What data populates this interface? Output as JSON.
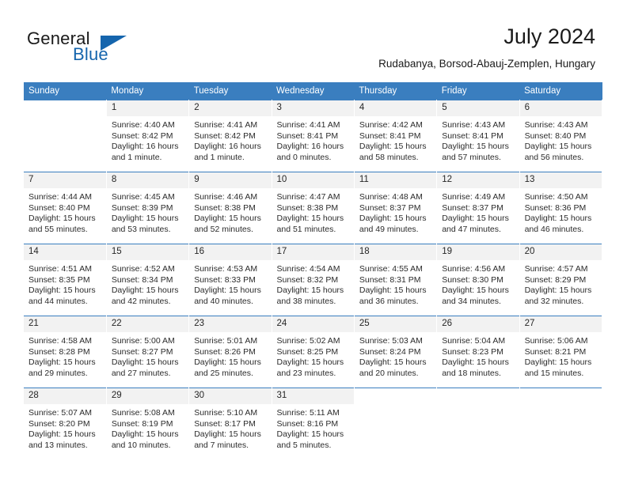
{
  "brand": {
    "name_part1": "General",
    "name_part2": "Blue",
    "accent_color": "#1565ad",
    "logo_icon": "triangle-flag-icon"
  },
  "header": {
    "title": "July 2024",
    "subtitle": "Rudabanya, Borsod-Abauj-Zemplen, Hungary"
  },
  "calendar": {
    "header_bg": "#3a7ebf",
    "daynum_bg": "#f2f2f2",
    "weekday_headers": [
      "Sunday",
      "Monday",
      "Tuesday",
      "Wednesday",
      "Thursday",
      "Friday",
      "Saturday"
    ],
    "weeks": [
      [
        {
          "day": "",
          "blank": true,
          "sunrise": "",
          "sunset": "",
          "daylight": ""
        },
        {
          "day": "1",
          "sunrise": "Sunrise: 4:40 AM",
          "sunset": "Sunset: 8:42 PM",
          "daylight": "Daylight: 16 hours and 1 minute."
        },
        {
          "day": "2",
          "sunrise": "Sunrise: 4:41 AM",
          "sunset": "Sunset: 8:42 PM",
          "daylight": "Daylight: 16 hours and 1 minute."
        },
        {
          "day": "3",
          "sunrise": "Sunrise: 4:41 AM",
          "sunset": "Sunset: 8:41 PM",
          "daylight": "Daylight: 16 hours and 0 minutes."
        },
        {
          "day": "4",
          "sunrise": "Sunrise: 4:42 AM",
          "sunset": "Sunset: 8:41 PM",
          "daylight": "Daylight: 15 hours and 58 minutes."
        },
        {
          "day": "5",
          "sunrise": "Sunrise: 4:43 AM",
          "sunset": "Sunset: 8:41 PM",
          "daylight": "Daylight: 15 hours and 57 minutes."
        },
        {
          "day": "6",
          "sunrise": "Sunrise: 4:43 AM",
          "sunset": "Sunset: 8:40 PM",
          "daylight": "Daylight: 15 hours and 56 minutes."
        }
      ],
      [
        {
          "day": "7",
          "sunrise": "Sunrise: 4:44 AM",
          "sunset": "Sunset: 8:40 PM",
          "daylight": "Daylight: 15 hours and 55 minutes."
        },
        {
          "day": "8",
          "sunrise": "Sunrise: 4:45 AM",
          "sunset": "Sunset: 8:39 PM",
          "daylight": "Daylight: 15 hours and 53 minutes."
        },
        {
          "day": "9",
          "sunrise": "Sunrise: 4:46 AM",
          "sunset": "Sunset: 8:38 PM",
          "daylight": "Daylight: 15 hours and 52 minutes."
        },
        {
          "day": "10",
          "sunrise": "Sunrise: 4:47 AM",
          "sunset": "Sunset: 8:38 PM",
          "daylight": "Daylight: 15 hours and 51 minutes."
        },
        {
          "day": "11",
          "sunrise": "Sunrise: 4:48 AM",
          "sunset": "Sunset: 8:37 PM",
          "daylight": "Daylight: 15 hours and 49 minutes."
        },
        {
          "day": "12",
          "sunrise": "Sunrise: 4:49 AM",
          "sunset": "Sunset: 8:37 PM",
          "daylight": "Daylight: 15 hours and 47 minutes."
        },
        {
          "day": "13",
          "sunrise": "Sunrise: 4:50 AM",
          "sunset": "Sunset: 8:36 PM",
          "daylight": "Daylight: 15 hours and 46 minutes."
        }
      ],
      [
        {
          "day": "14",
          "sunrise": "Sunrise: 4:51 AM",
          "sunset": "Sunset: 8:35 PM",
          "daylight": "Daylight: 15 hours and 44 minutes."
        },
        {
          "day": "15",
          "sunrise": "Sunrise: 4:52 AM",
          "sunset": "Sunset: 8:34 PM",
          "daylight": "Daylight: 15 hours and 42 minutes."
        },
        {
          "day": "16",
          "sunrise": "Sunrise: 4:53 AM",
          "sunset": "Sunset: 8:33 PM",
          "daylight": "Daylight: 15 hours and 40 minutes."
        },
        {
          "day": "17",
          "sunrise": "Sunrise: 4:54 AM",
          "sunset": "Sunset: 8:32 PM",
          "daylight": "Daylight: 15 hours and 38 minutes."
        },
        {
          "day": "18",
          "sunrise": "Sunrise: 4:55 AM",
          "sunset": "Sunset: 8:31 PM",
          "daylight": "Daylight: 15 hours and 36 minutes."
        },
        {
          "day": "19",
          "sunrise": "Sunrise: 4:56 AM",
          "sunset": "Sunset: 8:30 PM",
          "daylight": "Daylight: 15 hours and 34 minutes."
        },
        {
          "day": "20",
          "sunrise": "Sunrise: 4:57 AM",
          "sunset": "Sunset: 8:29 PM",
          "daylight": "Daylight: 15 hours and 32 minutes."
        }
      ],
      [
        {
          "day": "21",
          "sunrise": "Sunrise: 4:58 AM",
          "sunset": "Sunset: 8:28 PM",
          "daylight": "Daylight: 15 hours and 29 minutes."
        },
        {
          "day": "22",
          "sunrise": "Sunrise: 5:00 AM",
          "sunset": "Sunset: 8:27 PM",
          "daylight": "Daylight: 15 hours and 27 minutes."
        },
        {
          "day": "23",
          "sunrise": "Sunrise: 5:01 AM",
          "sunset": "Sunset: 8:26 PM",
          "daylight": "Daylight: 15 hours and 25 minutes."
        },
        {
          "day": "24",
          "sunrise": "Sunrise: 5:02 AM",
          "sunset": "Sunset: 8:25 PM",
          "daylight": "Daylight: 15 hours and 23 minutes."
        },
        {
          "day": "25",
          "sunrise": "Sunrise: 5:03 AM",
          "sunset": "Sunset: 8:24 PM",
          "daylight": "Daylight: 15 hours and 20 minutes."
        },
        {
          "day": "26",
          "sunrise": "Sunrise: 5:04 AM",
          "sunset": "Sunset: 8:23 PM",
          "daylight": "Daylight: 15 hours and 18 minutes."
        },
        {
          "day": "27",
          "sunrise": "Sunrise: 5:06 AM",
          "sunset": "Sunset: 8:21 PM",
          "daylight": "Daylight: 15 hours and 15 minutes."
        }
      ],
      [
        {
          "day": "28",
          "sunrise": "Sunrise: 5:07 AM",
          "sunset": "Sunset: 8:20 PM",
          "daylight": "Daylight: 15 hours and 13 minutes."
        },
        {
          "day": "29",
          "sunrise": "Sunrise: 5:08 AM",
          "sunset": "Sunset: 8:19 PM",
          "daylight": "Daylight: 15 hours and 10 minutes."
        },
        {
          "day": "30",
          "sunrise": "Sunrise: 5:10 AM",
          "sunset": "Sunset: 8:17 PM",
          "daylight": "Daylight: 15 hours and 7 minutes."
        },
        {
          "day": "31",
          "sunrise": "Sunrise: 5:11 AM",
          "sunset": "Sunset: 8:16 PM",
          "daylight": "Daylight: 15 hours and 5 minutes."
        },
        {
          "day": "",
          "blank": true,
          "sunrise": "",
          "sunset": "",
          "daylight": ""
        },
        {
          "day": "",
          "blank": true,
          "sunrise": "",
          "sunset": "",
          "daylight": ""
        },
        {
          "day": "",
          "blank": true,
          "sunrise": "",
          "sunset": "",
          "daylight": ""
        }
      ]
    ]
  }
}
